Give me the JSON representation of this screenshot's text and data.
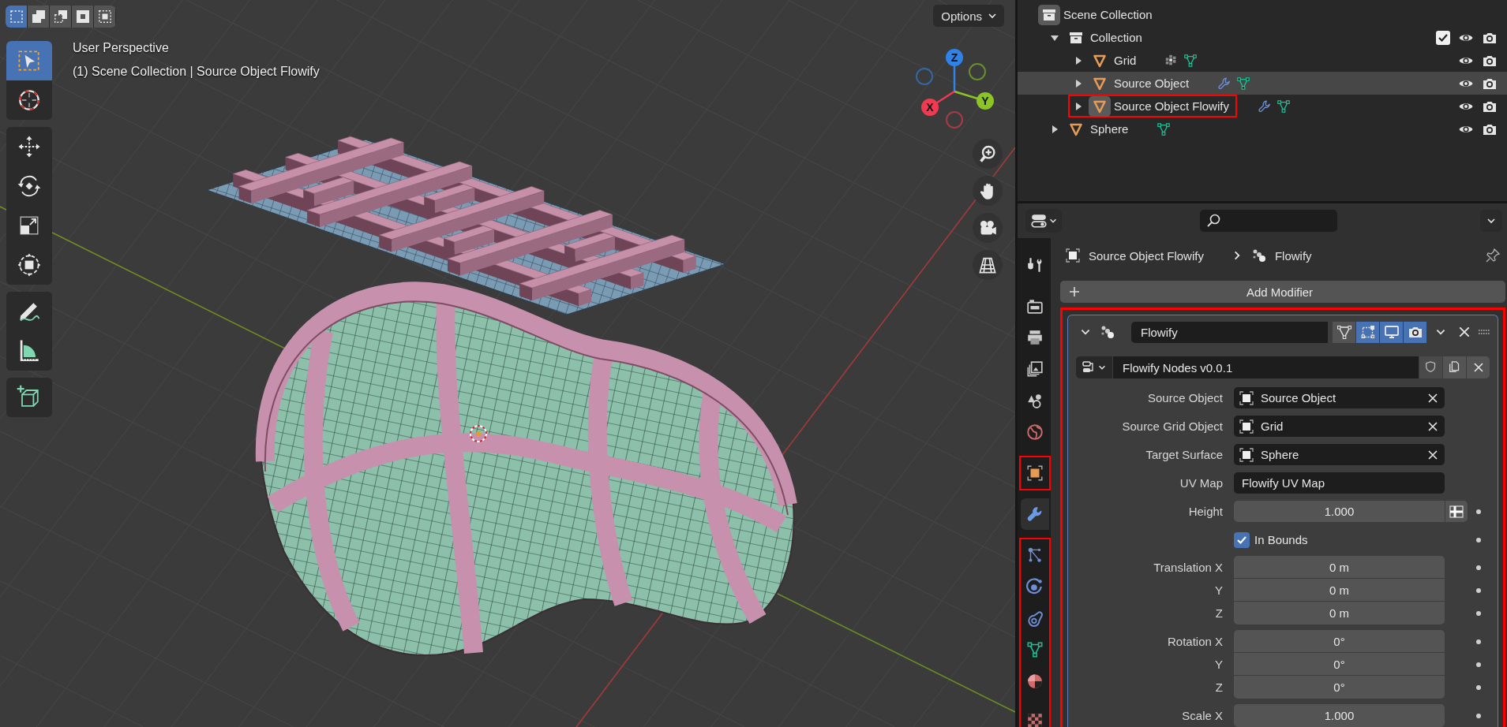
{
  "viewport": {
    "select_modes": [
      {
        "kind": "new",
        "selected": true
      },
      {
        "kind": "extend",
        "selected": false
      },
      {
        "kind": "subtract",
        "selected": false
      },
      {
        "kind": "difference",
        "selected": false
      },
      {
        "kind": "intersect",
        "selected": false
      }
    ],
    "options": "Options",
    "view_name": "User Perspective",
    "view_info": "(1) Scene Collection | Source Object Flowify",
    "tool_groups": [
      {
        "tools": [
          {
            "kind": "select_box",
            "selected": true
          },
          {
            "kind": "cursor",
            "selected": false
          }
        ]
      },
      {
        "tools": [
          {
            "kind": "move",
            "selected": false
          },
          {
            "kind": "rotate",
            "selected": false
          },
          {
            "kind": "scale",
            "selected": false
          },
          {
            "kind": "transform",
            "selected": false
          }
        ]
      },
      {
        "tools": [
          {
            "kind": "annotate",
            "selected": false
          },
          {
            "kind": "measure",
            "selected": false
          }
        ]
      },
      {
        "tools": [
          {
            "kind": "add_cube",
            "selected": false
          }
        ]
      }
    ],
    "gizmo_axes": [
      {
        "label": "Z",
        "color": "#2f83e8"
      },
      {
        "label": "Y",
        "color": "#8bc424"
      },
      {
        "label": "X",
        "color": "#f03a52"
      }
    ],
    "nav_buttons": [
      {
        "kind": "zoom"
      },
      {
        "kind": "pan"
      },
      {
        "kind": "camera"
      },
      {
        "kind": "ortho"
      }
    ]
  },
  "outliner": {
    "root": "Scene Collection",
    "items": [
      {
        "label": "Collection",
        "kind": "collection",
        "expanded": true,
        "checked": true,
        "selected": false,
        "active": false,
        "highlighted": false,
        "children": [
          {
            "label": "Grid",
            "kind": "mesh",
            "expanded": false,
            "selected": false,
            "active": false,
            "highlighted": false,
            "badges": [
              {
                "kind": "particles"
              },
              {
                "kind": "mesh_data"
              }
            ]
          },
          {
            "label": "Source Object",
            "kind": "mesh",
            "expanded": false,
            "selected": true,
            "active": false,
            "highlighted": false,
            "badges": [
              {
                "kind": "modifier"
              },
              {
                "kind": "mesh_data"
              }
            ]
          },
          {
            "label": "Source Object Flowify",
            "kind": "mesh",
            "expanded": false,
            "selected": false,
            "active": true,
            "highlighted": true,
            "badges": [
              {
                "kind": "modifier"
              },
              {
                "kind": "mesh_data"
              }
            ]
          }
        ]
      },
      {
        "label": "Sphere",
        "kind": "mesh",
        "expanded": false,
        "selected": false,
        "active": false,
        "highlighted": false,
        "badges": [
          {
            "kind": "mesh_data"
          }
        ]
      }
    ]
  },
  "properties": {
    "tab_groups": [
      {
        "highlighted": false,
        "tabs": [
          {
            "kind": "tool",
            "selected": false
          }
        ]
      },
      {
        "highlighted": false,
        "tabs": [
          {
            "kind": "render",
            "selected": false
          },
          {
            "kind": "output",
            "selected": false
          },
          {
            "kind": "view_layer",
            "selected": false
          },
          {
            "kind": "scene",
            "selected": false
          },
          {
            "kind": "world",
            "selected": false
          }
        ]
      },
      {
        "highlighted": true,
        "tabs": [
          {
            "kind": "object",
            "selected": false
          }
        ]
      },
      {
        "highlighted": false,
        "tabs": [
          {
            "kind": "modifier",
            "selected": true
          }
        ]
      },
      {
        "highlighted": true,
        "tabs": [
          {
            "kind": "particles",
            "selected": false
          },
          {
            "kind": "physics",
            "selected": false
          },
          {
            "kind": "constraints",
            "selected": false
          },
          {
            "kind": "data",
            "selected": false
          },
          {
            "kind": "material",
            "selected": false
          },
          {
            "kind": "texture",
            "selected": false
          }
        ]
      }
    ],
    "breadcrumb": {
      "object": "Source Object Flowify",
      "modifier": "Flowify"
    },
    "add_modifier": "Add Modifier",
    "modifier": {
      "name": "Flowify",
      "expanded": true,
      "highlighted": true,
      "toggles": [
        {
          "kind": "on_cage",
          "on": false
        },
        {
          "kind": "edit_mode",
          "on": true
        },
        {
          "kind": "viewport",
          "on": true
        },
        {
          "kind": "render",
          "on": true
        }
      ],
      "node_group": "Flowify Nodes v0.0.1",
      "fields": [
        {
          "kind": "object",
          "label": "Source Object",
          "value": "Source Object"
        },
        {
          "kind": "object",
          "label": "Source Grid Object",
          "value": "Grid"
        },
        {
          "kind": "object",
          "label": "Target Surface",
          "value": "Sphere"
        },
        {
          "kind": "text",
          "label": "UV Map",
          "value": "Flowify UV Map"
        },
        {
          "kind": "number",
          "label": "Height",
          "value": "1.000",
          "attribute_toggle": true
        },
        {
          "kind": "checkbox",
          "label": "In Bounds",
          "checked": true
        },
        {
          "kind": "vector",
          "rows": [
            {
              "label": "Translation X",
              "value": "0 m"
            },
            {
              "label": "Y",
              "value": "0 m"
            },
            {
              "label": "Z",
              "value": "0 m"
            }
          ]
        },
        {
          "kind": "vector",
          "rows": [
            {
              "label": "Rotation X",
              "value": "0°"
            },
            {
              "label": "Y",
              "value": "0°"
            },
            {
              "label": "Z",
              "value": "0°"
            }
          ]
        },
        {
          "kind": "vector",
          "rows": [
            {
              "label": "Scale X",
              "value": "1.000"
            }
          ]
        }
      ]
    }
  }
}
